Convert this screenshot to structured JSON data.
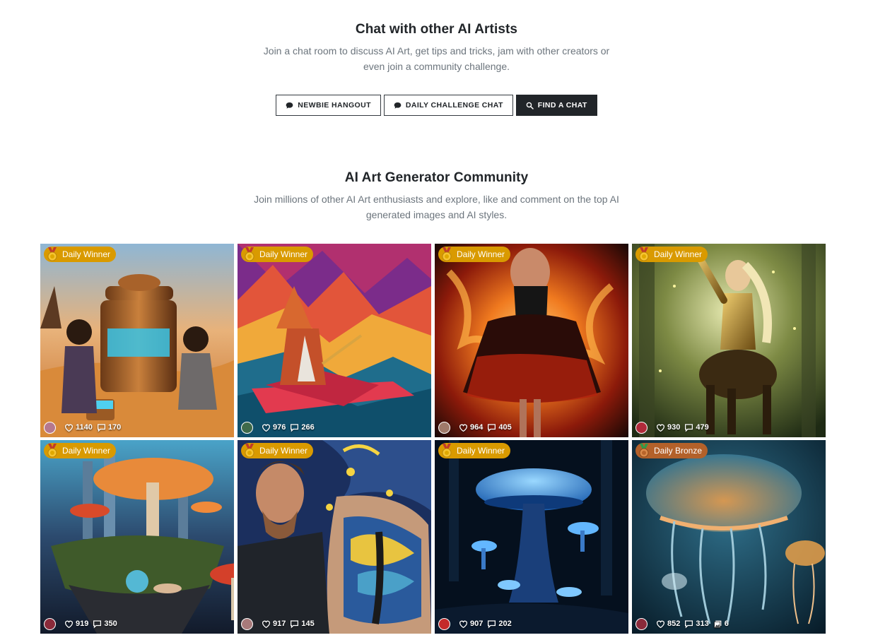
{
  "chat_section": {
    "title": "Chat with other AI Artists",
    "subtitle": "Join a chat room to discuss AI Art, get tips and tricks, jam with other creators or even join a community challenge.",
    "buttons": [
      {
        "label": "Newbie Hangout",
        "icon": "chat-bubble-icon"
      },
      {
        "label": "Daily Challenge Chat",
        "icon": "chat-bubble-icon"
      },
      {
        "label": "Find a Chat",
        "icon": "search-icon"
      }
    ]
  },
  "community_section": {
    "title": "AI Art Generator Community",
    "subtitle": "Join millions of other AI Art enthusiasts and explore, like and comment on the top AI generated images and AI styles."
  },
  "colors": {
    "winner_badge": "#d99a00",
    "bronze_badge": "#b3612a",
    "dark_button": "#212529"
  },
  "gallery": [
    {
      "badge": "Daily Winner",
      "badge_type": "gold",
      "likes": "1140",
      "comments": "170",
      "subject": "children with copper water machine in desert"
    },
    {
      "badge": "Daily Winner",
      "badge_type": "gold",
      "likes": "976",
      "comments": "266",
      "subject": "origami wizard in paper boat"
    },
    {
      "badge": "Daily Winner",
      "badge_type": "gold",
      "likes": "964",
      "comments": "405",
      "subject": "dancer in fiery skirt"
    },
    {
      "badge": "Daily Winner",
      "badge_type": "gold",
      "likes": "930",
      "comments": "479",
      "subject": "golden centaur warrior in forest"
    },
    {
      "badge": "Daily Winner",
      "badge_type": "gold",
      "likes": "919",
      "comments": "350",
      "subject": "mushroom castle island"
    },
    {
      "badge": "Daily Winner",
      "badge_type": "gold",
      "likes": "917",
      "comments": "145",
      "subject": "tattoo artist painting starry night on back"
    },
    {
      "badge": "Daily Winner",
      "badge_type": "gold",
      "likes": "907",
      "comments": "202",
      "subject": "glowing blue mushrooms"
    },
    {
      "badge": "Daily Bronze",
      "badge_type": "bronze",
      "likes": "852",
      "comments": "313",
      "images": "6",
      "subject": "glowing jellyfish"
    }
  ]
}
